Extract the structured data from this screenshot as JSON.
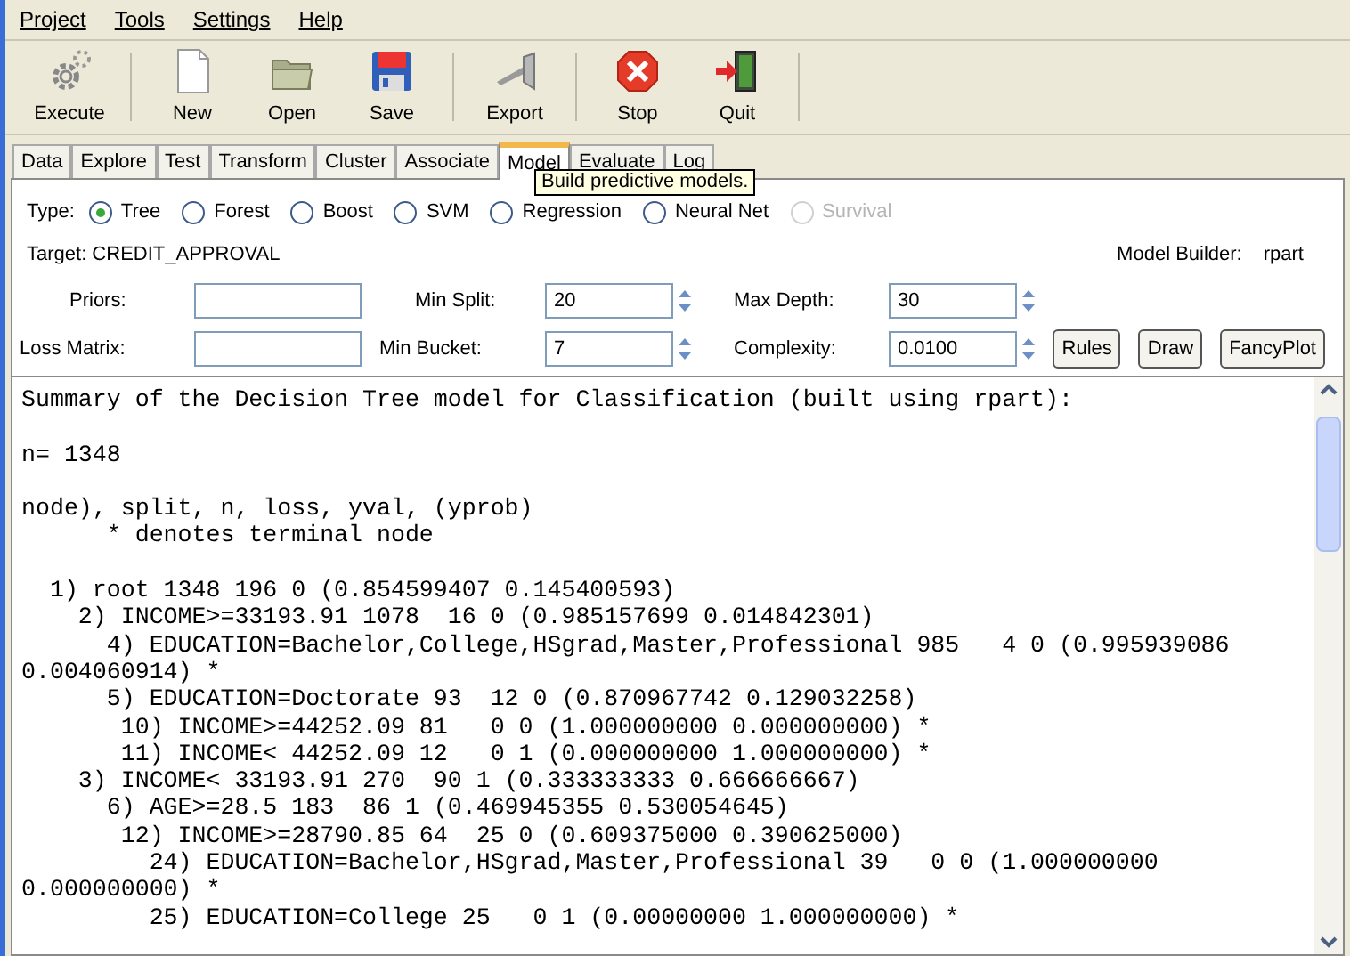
{
  "menu": [
    "Project",
    "Tools",
    "Settings",
    "Help"
  ],
  "toolbar": [
    {
      "label": "Execute",
      "kind": "gears"
    },
    {
      "label": "New",
      "kind": "new"
    },
    {
      "label": "Open",
      "kind": "open"
    },
    {
      "label": "Save",
      "kind": "save"
    },
    {
      "label": "Export",
      "kind": "export"
    },
    {
      "label": "Stop",
      "kind": "stop"
    },
    {
      "label": "Quit",
      "kind": "quit"
    }
  ],
  "tabs": [
    {
      "label": "Data",
      "selected": false
    },
    {
      "label": "Explore",
      "selected": false
    },
    {
      "label": "Test",
      "selected": false
    },
    {
      "label": "Transform",
      "selected": false
    },
    {
      "label": "Cluster",
      "selected": false
    },
    {
      "label": "Associate",
      "selected": false
    },
    {
      "label": "Model",
      "selected": true
    },
    {
      "label": "Evaluate",
      "selected": false
    },
    {
      "label": "Log",
      "selected": false
    }
  ],
  "tooltip": "Build predictive models.",
  "type_label": "Type:",
  "types": [
    {
      "label": "Tree",
      "selected": true,
      "disabled": false
    },
    {
      "label": "Forest",
      "selected": false,
      "disabled": false
    },
    {
      "label": "Boost",
      "selected": false,
      "disabled": false
    },
    {
      "label": "SVM",
      "selected": false,
      "disabled": false
    },
    {
      "label": "Regression",
      "selected": false,
      "disabled": false
    },
    {
      "label": "Neural Net",
      "selected": false,
      "disabled": false
    },
    {
      "label": "Survival",
      "selected": false,
      "disabled": true
    }
  ],
  "target": "Target: CREDIT_APPROVAL",
  "model_builder": {
    "label": "Model Builder:",
    "value": "rpart"
  },
  "fields": [
    {
      "label": "Priors:"
    },
    {
      "label": "Loss Matrix:"
    }
  ],
  "spinners": [
    {
      "label": "Min Split:",
      "value": "20"
    },
    {
      "label": "Max Depth:",
      "value": "30"
    },
    {
      "label": "Min Bucket:",
      "value": "7"
    },
    {
      "label": "Complexity:",
      "value": "0.0100"
    }
  ],
  "buttons": [
    "Rules",
    "Draw",
    "FancyPlot"
  ],
  "output": [
    [
      "Summary of the Decision Tree model for Classification (built using rpart):"
    ],
    [
      "n= 1348"
    ],
    [
      "node), split, n, loss, yval, (yprob)",
      "      * denotes terminal node"
    ],
    [
      "  1) root 1348 196 0 (0.854599407 0.145400593)",
      "    2) INCOME>=33193.91 1078  16 0 (0.985157699 0.014842301)",
      "      4) EDUCATION=Bachelor,College,HSgrad,Master,Professional 985   4 0 (0.995939086",
      "0.004060914) *",
      "      5) EDUCATION=Doctorate 93  12 0 (0.870967742 0.129032258)",
      "       10) INCOME>=44252.09 81   0 0 (1.000000000 0.000000000) *",
      "       11) INCOME< 44252.09 12   0 1 (0.000000000 1.000000000) *",
      "    3) INCOME< 33193.91 270  90 1 (0.333333333 0.666666667)",
      "      6) AGE>=28.5 183  86 1 (0.469945355 0.530054645)",
      "       12) INCOME>=28790.85 64  25 0 (0.609375000 0.390625000)",
      "         24) EDUCATION=Bachelor,HSgrad,Master,Professional 39   0 0 (1.000000000",
      "0.000000000) *",
      "         25) EDUCATION=College 25   0 1 (0.00000000 1.000000000) *"
    ]
  ]
}
